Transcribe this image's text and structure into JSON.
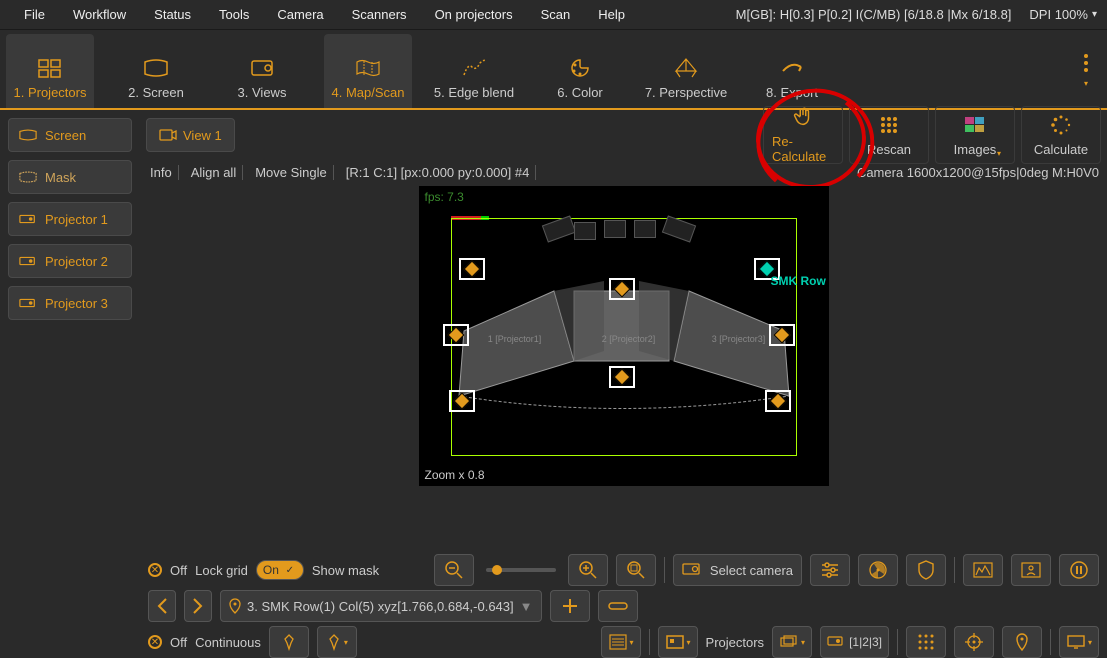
{
  "menubar": {
    "items": [
      "File",
      "Workflow",
      "Status",
      "Tools",
      "Camera",
      "Scanners",
      "On projectors",
      "Scan",
      "Help"
    ],
    "status": "M[GB]: H[0.3] P[0.2] I(C/MB) [6/18.8 |Mx 6/18.8]",
    "dpi": "DPI 100%"
  },
  "tabs": {
    "items": [
      {
        "label": "1. Projectors",
        "active": true
      },
      {
        "label": "2. Screen",
        "active": false
      },
      {
        "label": "3. Views",
        "active": false
      },
      {
        "label": "4. Map/Scan",
        "active": true
      },
      {
        "label": "5. Edge blend",
        "active": false
      },
      {
        "label": "6. Color",
        "active": false
      },
      {
        "label": "7. Perspective",
        "active": false
      },
      {
        "label": "8. Export",
        "active": false
      }
    ]
  },
  "sidebar": {
    "items": [
      {
        "label": "Screen"
      },
      {
        "label": "Mask"
      },
      {
        "label": "Projector 1"
      },
      {
        "label": "Projector 2"
      },
      {
        "label": "Projector 3"
      }
    ]
  },
  "viewtab": {
    "label": "View 1"
  },
  "actions": {
    "recalc": "Re-Calculate",
    "rescan": "Rescan",
    "images": "Images",
    "calculate": "Calculate"
  },
  "infobar": {
    "info": "Info",
    "align": "Align all",
    "move": "Move Single",
    "rc": "[R:1 C:1] [px:0.000 py:0.000] #4",
    "camera": "Camera 1600x1200@15fps|0deg M:H0V0"
  },
  "canvas": {
    "fps": "fps: 7.3",
    "zoom": "Zoom x 0.8",
    "smk": "SMK Row",
    "p1": "1 [Projector1]",
    "p2": "2 [Projector2]",
    "p3": "3 [Projector3]"
  },
  "bottom": {
    "off1": "Off",
    "lockgrid": "Lock grid",
    "on": "On",
    "showmask": "Show mask",
    "selectcamera": "Select camera",
    "navpoint": "3. SMK Row(1) Col(5) xyz[1.766,0.684,-0.643]",
    "off2": "Off",
    "continuous": "Continuous",
    "projectors": "Projectors",
    "projcount": "[1|2|3]"
  }
}
